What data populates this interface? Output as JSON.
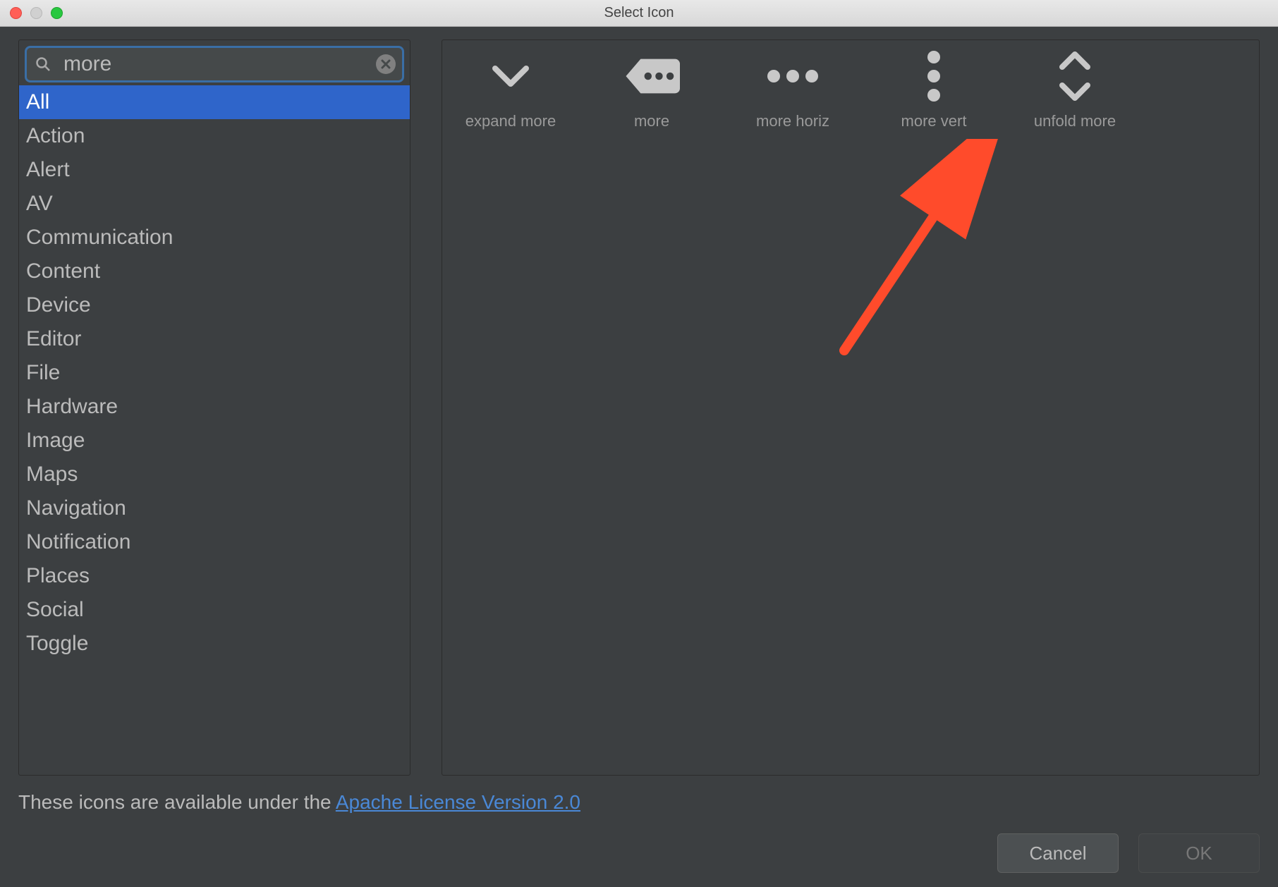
{
  "window": {
    "title": "Select Icon"
  },
  "search": {
    "value": "more"
  },
  "categories": {
    "items": [
      "All",
      "Action",
      "Alert",
      "AV",
      "Communication",
      "Content",
      "Device",
      "Editor",
      "File",
      "Hardware",
      "Image",
      "Maps",
      "Navigation",
      "Notification",
      "Places",
      "Social",
      "Toggle"
    ],
    "selected_index": 0
  },
  "icons": {
    "items": [
      {
        "name": "expand more",
        "glyph": "expand-more"
      },
      {
        "name": "more",
        "glyph": "more"
      },
      {
        "name": "more horiz",
        "glyph": "more-horiz"
      },
      {
        "name": "more vert",
        "glyph": "more-vert"
      },
      {
        "name": "unfold more",
        "glyph": "unfold-more"
      }
    ]
  },
  "footer": {
    "prefix": "These icons are available under the ",
    "link_text": "Apache License Version 2.0"
  },
  "buttons": {
    "cancel": "Cancel",
    "ok": "OK"
  },
  "annotation": {
    "arrow_target": "more vert",
    "arrow_color": "#ff4b2b"
  }
}
